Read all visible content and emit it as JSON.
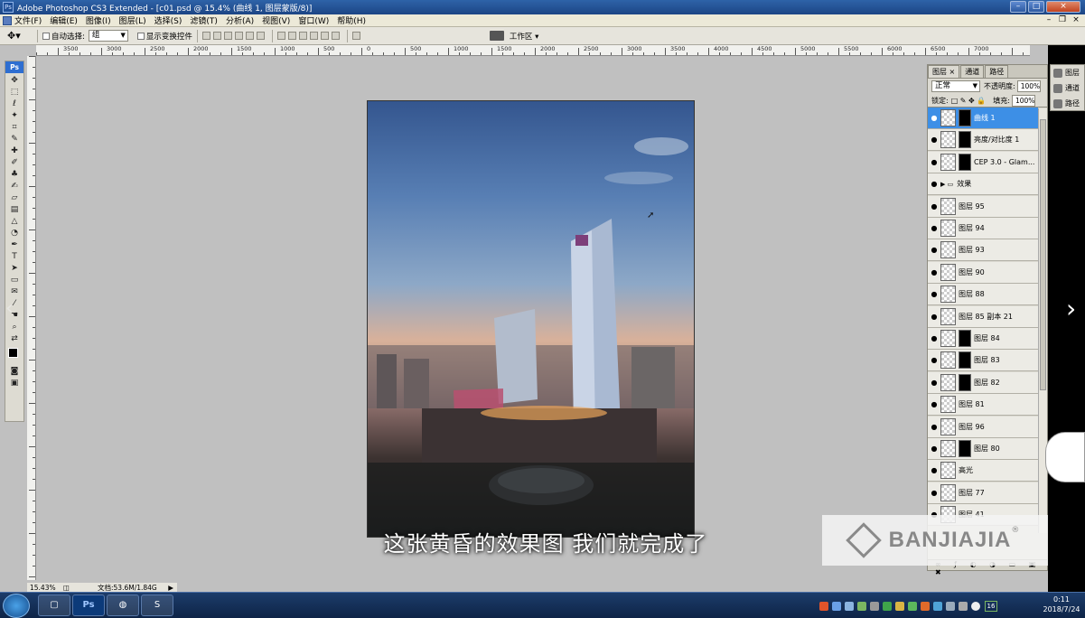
{
  "window": {
    "title": "Adobe Photoshop CS3 Extended - [c01.psd @ 15.4% (曲线 1, 图层蒙版/8)]",
    "app_badge": "Ps"
  },
  "menu": [
    "文件(F)",
    "编辑(E)",
    "图像(I)",
    "图层(L)",
    "选择(S)",
    "滤镜(T)",
    "分析(A)",
    "视图(V)",
    "窗口(W)",
    "帮助(H)"
  ],
  "options_bar": {
    "auto_select_label": "自动选择:",
    "auto_select_value": "组",
    "show_transform_label": "显示变换控件",
    "workspace_label": "工作区"
  },
  "ruler": [
    "3500",
    "3000",
    "2500",
    "2000",
    "1500",
    "1000",
    "500",
    "0",
    "500",
    "1000",
    "1500",
    "2000",
    "2500",
    "3000",
    "3500",
    "4000",
    "4500",
    "5000",
    "5500",
    "6000",
    "6500",
    "7000"
  ],
  "subtitle": "这张黄昏的效果图 我们就完成了",
  "watermark": {
    "brand": "BANJIAJIA",
    "reg": "®"
  },
  "layers_panel": {
    "tabs": [
      "图层",
      "通道",
      "路径"
    ],
    "blend_mode": "正常",
    "opacity_label": "不透明度:",
    "opacity_value": "100%",
    "lock_label": "锁定:",
    "fill_label": "填充:",
    "fill_value": "100%",
    "layers": [
      {
        "name": "曲线 1",
        "selected": true,
        "mask": true
      },
      {
        "name": "亮度/对比度 1",
        "selected": false,
        "mask": true
      },
      {
        "name": "CEP 3.0 - Glam...",
        "selected": false,
        "mask": true
      },
      {
        "name": "效果",
        "selected": false,
        "mask": false,
        "group": true
      },
      {
        "name": "图层 95",
        "selected": false,
        "mask": false
      },
      {
        "name": "图层 94",
        "selected": false,
        "mask": false
      },
      {
        "name": "图层 93",
        "selected": false,
        "mask": false
      },
      {
        "name": "图层 90",
        "selected": false,
        "mask": false
      },
      {
        "name": "图层 88",
        "selected": false,
        "mask": false
      },
      {
        "name": "图层 85 副本 21",
        "selected": false,
        "mask": false
      },
      {
        "name": "图层 84",
        "selected": false,
        "mask": true
      },
      {
        "name": "图层 83",
        "selected": false,
        "mask": true
      },
      {
        "name": "图层 82",
        "selected": false,
        "mask": true
      },
      {
        "name": "图层 81",
        "selected": false,
        "mask": false
      },
      {
        "name": "图层 96",
        "selected": false,
        "mask": false
      },
      {
        "name": "图层 80",
        "selected": false,
        "mask": true
      },
      {
        "name": "高光",
        "selected": false,
        "mask": false
      },
      {
        "name": "图层 77",
        "selected": false,
        "mask": false
      },
      {
        "name": "图层 41",
        "selected": false,
        "mask": false
      }
    ]
  },
  "mini_panel": [
    "图层",
    "通道",
    "路径"
  ],
  "status": {
    "zoom": "15.43%",
    "doc": "文档:53.6M/1.84G"
  },
  "clock": {
    "time": "0:11",
    "date": "2018/7/24"
  },
  "tray_badge": "16",
  "taskbar_apps": [
    "app-3d-icon",
    "photoshop-icon",
    "wechat-icon",
    "sogou-icon"
  ],
  "taskbar_ps_label": "Ps"
}
